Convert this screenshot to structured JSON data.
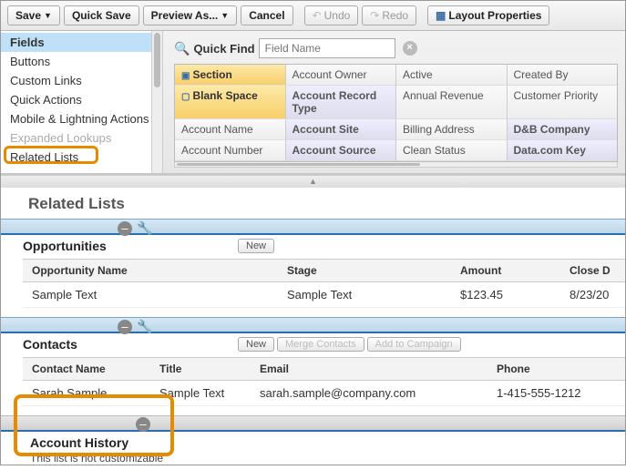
{
  "toolbar": {
    "save": "Save",
    "quicksave": "Quick Save",
    "preview": "Preview As...",
    "cancel": "Cancel",
    "undo": "Undo",
    "redo": "Redo",
    "layoutprops": "Layout Properties"
  },
  "leftnav": {
    "items": [
      "Fields",
      "Buttons",
      "Custom Links",
      "Quick Actions",
      "Mobile & Lightning Actions",
      "Expanded Lookups"
    ],
    "related": "Related Lists"
  },
  "quickfind": {
    "label": "Quick Find",
    "placeholder": "Field Name"
  },
  "palette": {
    "row0": [
      "Section",
      "Account Owner",
      "Active",
      "Created By"
    ],
    "row1": [
      "Blank Space",
      "Account Record Type",
      "Annual Revenue",
      "Customer Priority"
    ],
    "row2": [
      "Account Name",
      "Account Site",
      "Billing Address",
      "D&B Company"
    ],
    "row3": [
      "Account Number",
      "Account Source",
      "Clean Status",
      "Data.com Key"
    ]
  },
  "related": {
    "title": "Related Lists",
    "opps": {
      "name": "Opportunities",
      "new": "New",
      "cols": [
        "Opportunity Name",
        "Stage",
        "Amount",
        "Close D"
      ],
      "row": [
        "Sample Text",
        "Sample Text",
        "$123.45",
        "8/23/20"
      ]
    },
    "contacts": {
      "name": "Contacts",
      "new": "New",
      "merge": "Merge Contacts",
      "add": "Add to Campaign",
      "cols": [
        "Contact Name",
        "Title",
        "Email",
        "Phone"
      ],
      "row": [
        "Sarah Sample",
        "Sample Text",
        "sarah.sample@company.com",
        "1-415-555-1212"
      ]
    },
    "history": {
      "name": "Account History",
      "note": "This list is not customizable"
    }
  }
}
